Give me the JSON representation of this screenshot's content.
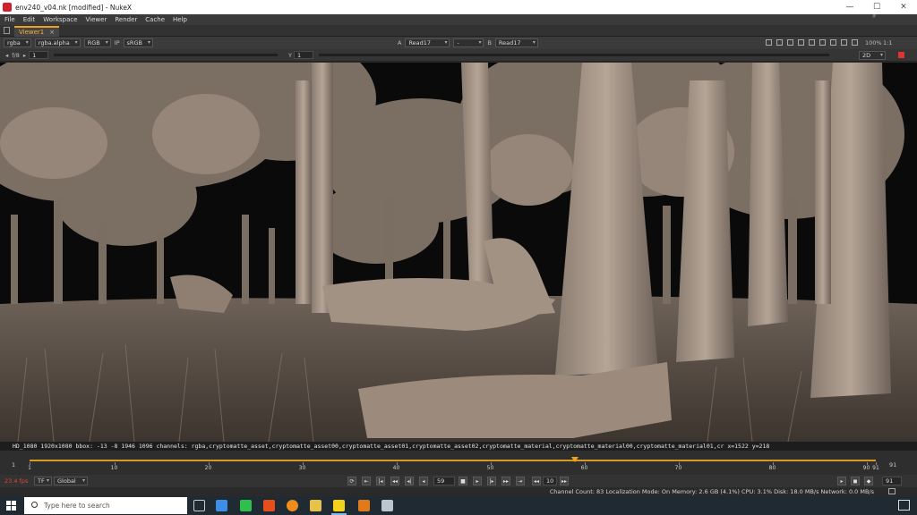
{
  "window": {
    "title": "env240_v04.nk [modified] - NukeX",
    "watermark": "fxphd",
    "minimize": "—",
    "maximize": "☐",
    "close": "✕"
  },
  "menu": [
    "File",
    "Edit",
    "Workspace",
    "Viewer",
    "Render",
    "Cache",
    "Help"
  ],
  "tab": {
    "label": "Viewer1",
    "close": "×"
  },
  "viewer_toolbar": {
    "channels": "rgba",
    "alpha": "rgba.alpha",
    "display": "RGB",
    "ip": "IP",
    "colorspace": "sRGB",
    "a_label": "A",
    "a_input": "Read17",
    "middle": "-",
    "b_label": "B",
    "b_input": "Read17",
    "zoom": "100%",
    "ratio": "1:1"
  },
  "viewer_toolbar2": {
    "fstop": "f/8",
    "gain": "1",
    "y_label": "Y",
    "gamma": "1",
    "mode": "2D"
  },
  "info_line": "HD_1080 1920x1080  bbox: -13 -8 1946 1096 channels: rgba,cryptomatte_asset,cryptomatte_asset00,cryptomatte_asset01,cryptomatte_asset02,cryptomatte_material,cryptomatte_material00,cryptomatte_material01,cr  x=1522 y=218",
  "timeline": {
    "start": "1",
    "end": "91",
    "ticks": [
      {
        "frame": 1,
        "label": "1"
      },
      {
        "frame": 10,
        "label": "10"
      },
      {
        "frame": 20,
        "label": "20"
      },
      {
        "frame": 30,
        "label": "30"
      },
      {
        "frame": 40,
        "label": "40"
      },
      {
        "frame": 50,
        "label": "50"
      },
      {
        "frame": 60,
        "label": "60"
      },
      {
        "frame": 70,
        "label": "70"
      },
      {
        "frame": 80,
        "label": "80"
      },
      {
        "frame": 90,
        "label": "90"
      },
      {
        "frame": 91,
        "label": "91"
      }
    ],
    "current_frame": 59,
    "left_value": "1",
    "right_value": "91"
  },
  "playback": {
    "fps": "23.4 fps",
    "tf": "TF",
    "scope": "Global",
    "current": "59",
    "step": "10",
    "end_field": "91"
  },
  "status": "Channel Count: 83  Localization Mode: On  Memory: 2.6 GB (4.1%)  CPU: 3.1%  Disk: 18.0 MB/s  Network: 0.0 MB/s",
  "taskbar": {
    "search_placeholder": "Type here to search"
  },
  "colors": {
    "accent": "#f0a020",
    "timeline": "#d99a25",
    "fps": "#e0413a"
  }
}
